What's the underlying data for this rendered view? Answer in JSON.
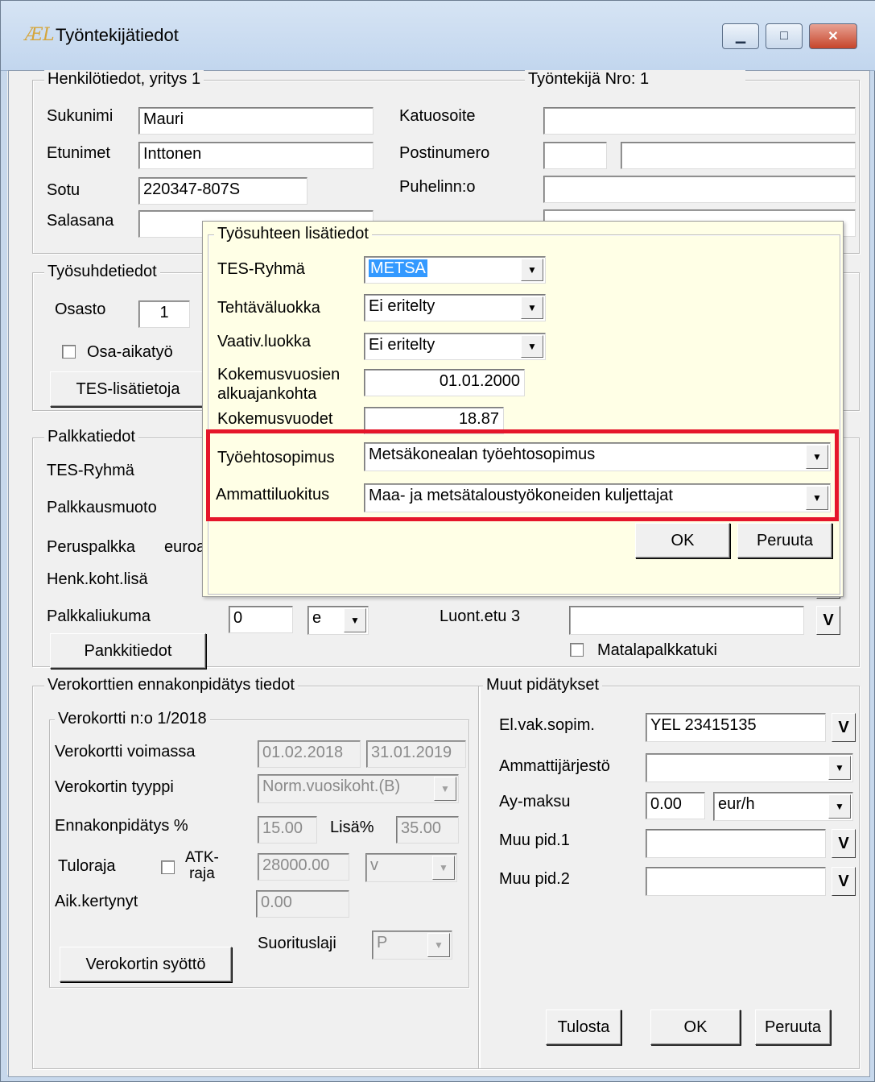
{
  "window": {
    "title": "Työntekijätiedot",
    "icon_text": "ÆL",
    "minimize": "▁",
    "maximize": "□",
    "close": "✕"
  },
  "henkilotiedot": {
    "legend": "Henkilötiedot, yritys 1",
    "tyontekija_nro": "Työntekijä Nro: 1",
    "sukunimi_label": "Sukunimi",
    "sukunimi_value": "Mauri",
    "etunimet_label": "Etunimet",
    "etunimet_value": "Inttonen",
    "sotu_label": "Sotu",
    "sotu_value": "220347-807S",
    "salasana_label": "Salasana",
    "katuosoite_label": "Katuosoite",
    "postinumero_label": "Postinumero",
    "puhelin_label": "Puhelinn:o"
  },
  "tyosuhde": {
    "legend": "Työsuhdetiedot",
    "osasto_label": "Osasto",
    "osasto_value": "1",
    "osa_aikatyo_label": "Osa-aikatyö",
    "tes_button": "TES-lisätietoja"
  },
  "palkka": {
    "legend": "Palkkatiedot",
    "tes_ryhma_label": "TES-Ryhmä",
    "palkkausmuoto_label": "Palkkausmuoto",
    "peruspalkka_label": "Peruspalkka",
    "peruspalkka_unit": "euroa",
    "henk_koht_label": "Henk.koht.lisä",
    "palkkaliukuma_label": "Palkkaliukuma",
    "palkkaliukuma_value": "0",
    "palkkaliukuma_unit": "e",
    "pankkitiedot_button": "Pankkitiedot",
    "luont_etu3_label": "Luont.etu 3",
    "matalapalkka_label": "Matalapalkkatuki",
    "v": "V"
  },
  "popup": {
    "legend": "Työsuhteen lisätiedot",
    "tes_ryhma_label": "TES-Ryhmä",
    "tes_ryhma_value": "METSA",
    "tehtava_label": "Tehtäväluokka",
    "tehtava_value": "Ei eritelty",
    "vaativ_label": "Vaativ.luokka",
    "vaativ_value": "Ei eritelty",
    "kokemus_alku_label1": "Kokemusvuosien",
    "kokemus_alku_label2": "alkuajankohta",
    "kokemus_alku_value": "01.01.2000",
    "kokemusvuodet_label": "Kokemusvuodet",
    "kokemusvuodet_value": "18.87",
    "tyoehto_label": "Työehtosopimus",
    "tyoehto_value": "Metsäkonealan työehtosopimus",
    "ammatti_label": "Ammattiluokitus",
    "ammatti_value": "Maa- ja metsätaloustyökoneiden kuljettajat",
    "ok_button": "OK",
    "peruuta_button": "Peruuta"
  },
  "verokortti": {
    "legend": "Verokorttien  ennakonpidätys tiedot",
    "sub_legend": "Verokortti n:o 1/2018",
    "voimassa_label": "Verokortti voimassa",
    "voimassa_from": "01.02.2018",
    "voimassa_to": "31.01.2019",
    "tyyppi_label": "Verokortin tyyppi",
    "tyyppi_value": "Norm.vuosikoht.(B)",
    "ennakko_label": "Ennakonpidätys %",
    "ennakko_value": "15.00",
    "lisa_label": "Lisä%",
    "lisa_value": "35.00",
    "tuloraja_label": "Tuloraja",
    "atk_label1": "ATK-",
    "atk_label2": "raja",
    "tuloraja_value": "28000.00",
    "tuloraja_unit": "v",
    "aik_label": "Aik.kertynyt",
    "aik_value": "0.00",
    "suorituslaji_label": "Suorituslaji",
    "suorituslaji_value": "P",
    "syotto_button": "Verokortin syöttö"
  },
  "muut": {
    "legend": "Muut pidätykset",
    "elvak_label": "El.vak.sopim.",
    "elvak_value": "YEL  23415135",
    "ammattijarjesto_label": "Ammattijärjestö",
    "aymaksu_label": "Ay-maksu",
    "aymaksu_value": "0.00",
    "aymaksu_unit": "eur/h",
    "muupid1_label": "Muu pid.1",
    "muupid2_label": "Muu pid.2",
    "v": "V"
  },
  "footer": {
    "tulosta": "Tulosta",
    "ok": "OK",
    "peruuta": "Peruuta"
  }
}
